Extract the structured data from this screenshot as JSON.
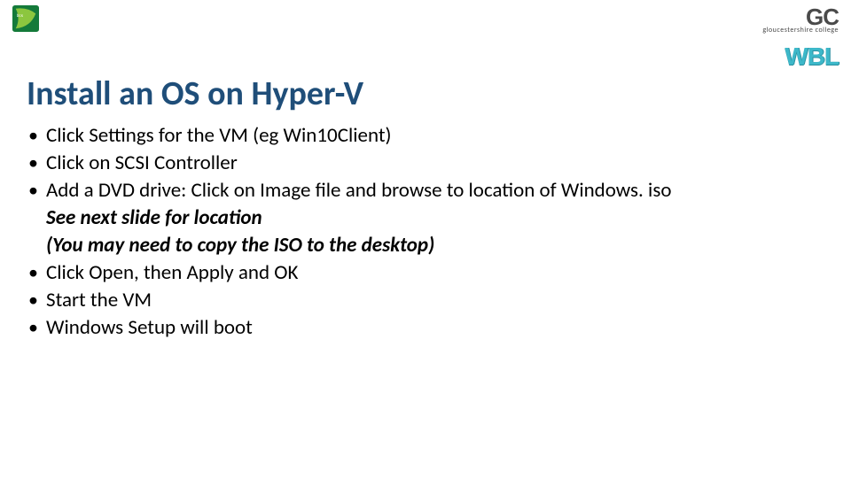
{
  "logos": {
    "bcs_alt": "BCS logo",
    "gc_mark": "GC",
    "gc_sub": "gloucestershire college",
    "wbl": "WBL"
  },
  "title": "Install an OS on Hyper-V",
  "bullets": [
    {
      "text": "Click Settings for the VM (eg Win10Client)"
    },
    {
      "text": "Click on SCSI Controller"
    },
    {
      "text": "Add a DVD drive: Click on Image file and browse to location of Windows. iso",
      "sub1": "See next slide for location",
      "sub2": "(You may need to copy the ISO to the desktop)"
    },
    {
      "text": "Click Open, then Apply and OK"
    },
    {
      "text": "Start the VM"
    },
    {
      "text": "Windows Setup will boot"
    }
  ]
}
